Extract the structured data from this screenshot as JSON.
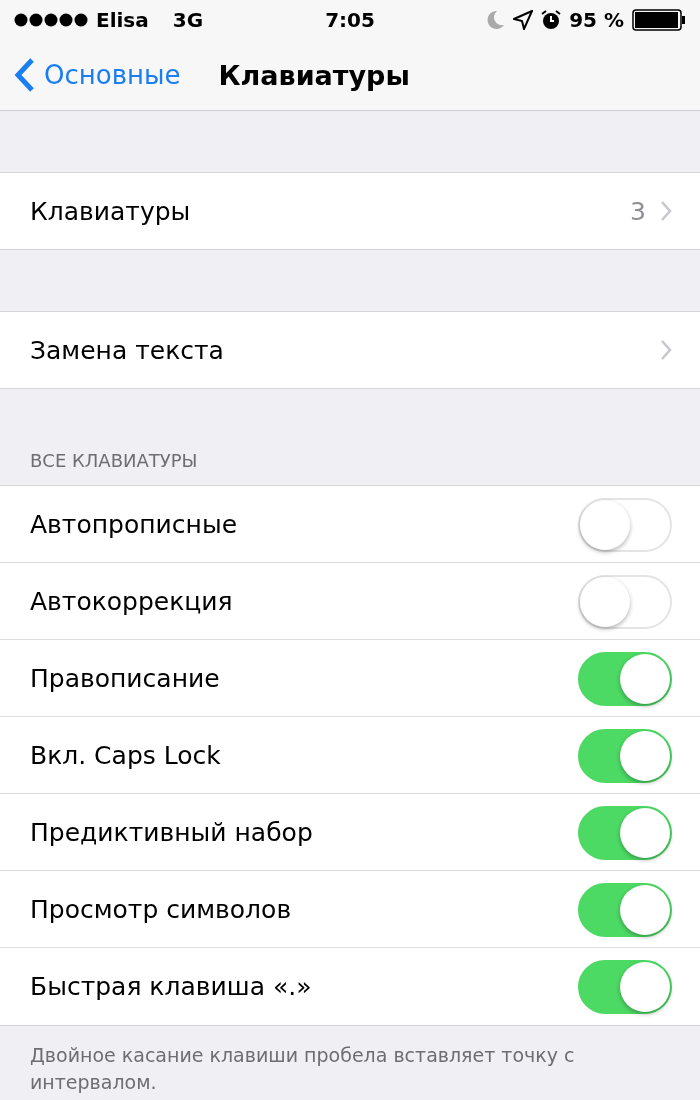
{
  "status_bar": {
    "carrier": "Elisa",
    "network": "3G",
    "time": "7:05",
    "battery_percent": "95 %"
  },
  "nav": {
    "back": "Основные",
    "title": "Клавиатуры"
  },
  "groups": [
    {
      "rows": [
        {
          "label": "Клавиатуры",
          "value": "3"
        }
      ]
    },
    {
      "rows": [
        {
          "label": "Замена текста"
        }
      ]
    }
  ],
  "section": {
    "header": "ВСЕ КЛАВИАТУРЫ",
    "rows": [
      {
        "label": "Автопрописные",
        "on": false
      },
      {
        "label": "Автокоррекция",
        "on": false
      },
      {
        "label": "Правописание",
        "on": true
      },
      {
        "label": "Вкл. Caps Lock",
        "on": true
      },
      {
        "label": "Предиктивный набор",
        "on": true
      },
      {
        "label": "Просмотр символов",
        "on": true
      },
      {
        "label": "Быстрая клавиша «.»",
        "on": true
      }
    ],
    "footer": "Двойное касание клавиши пробела вставляет точку с интервалом."
  }
}
